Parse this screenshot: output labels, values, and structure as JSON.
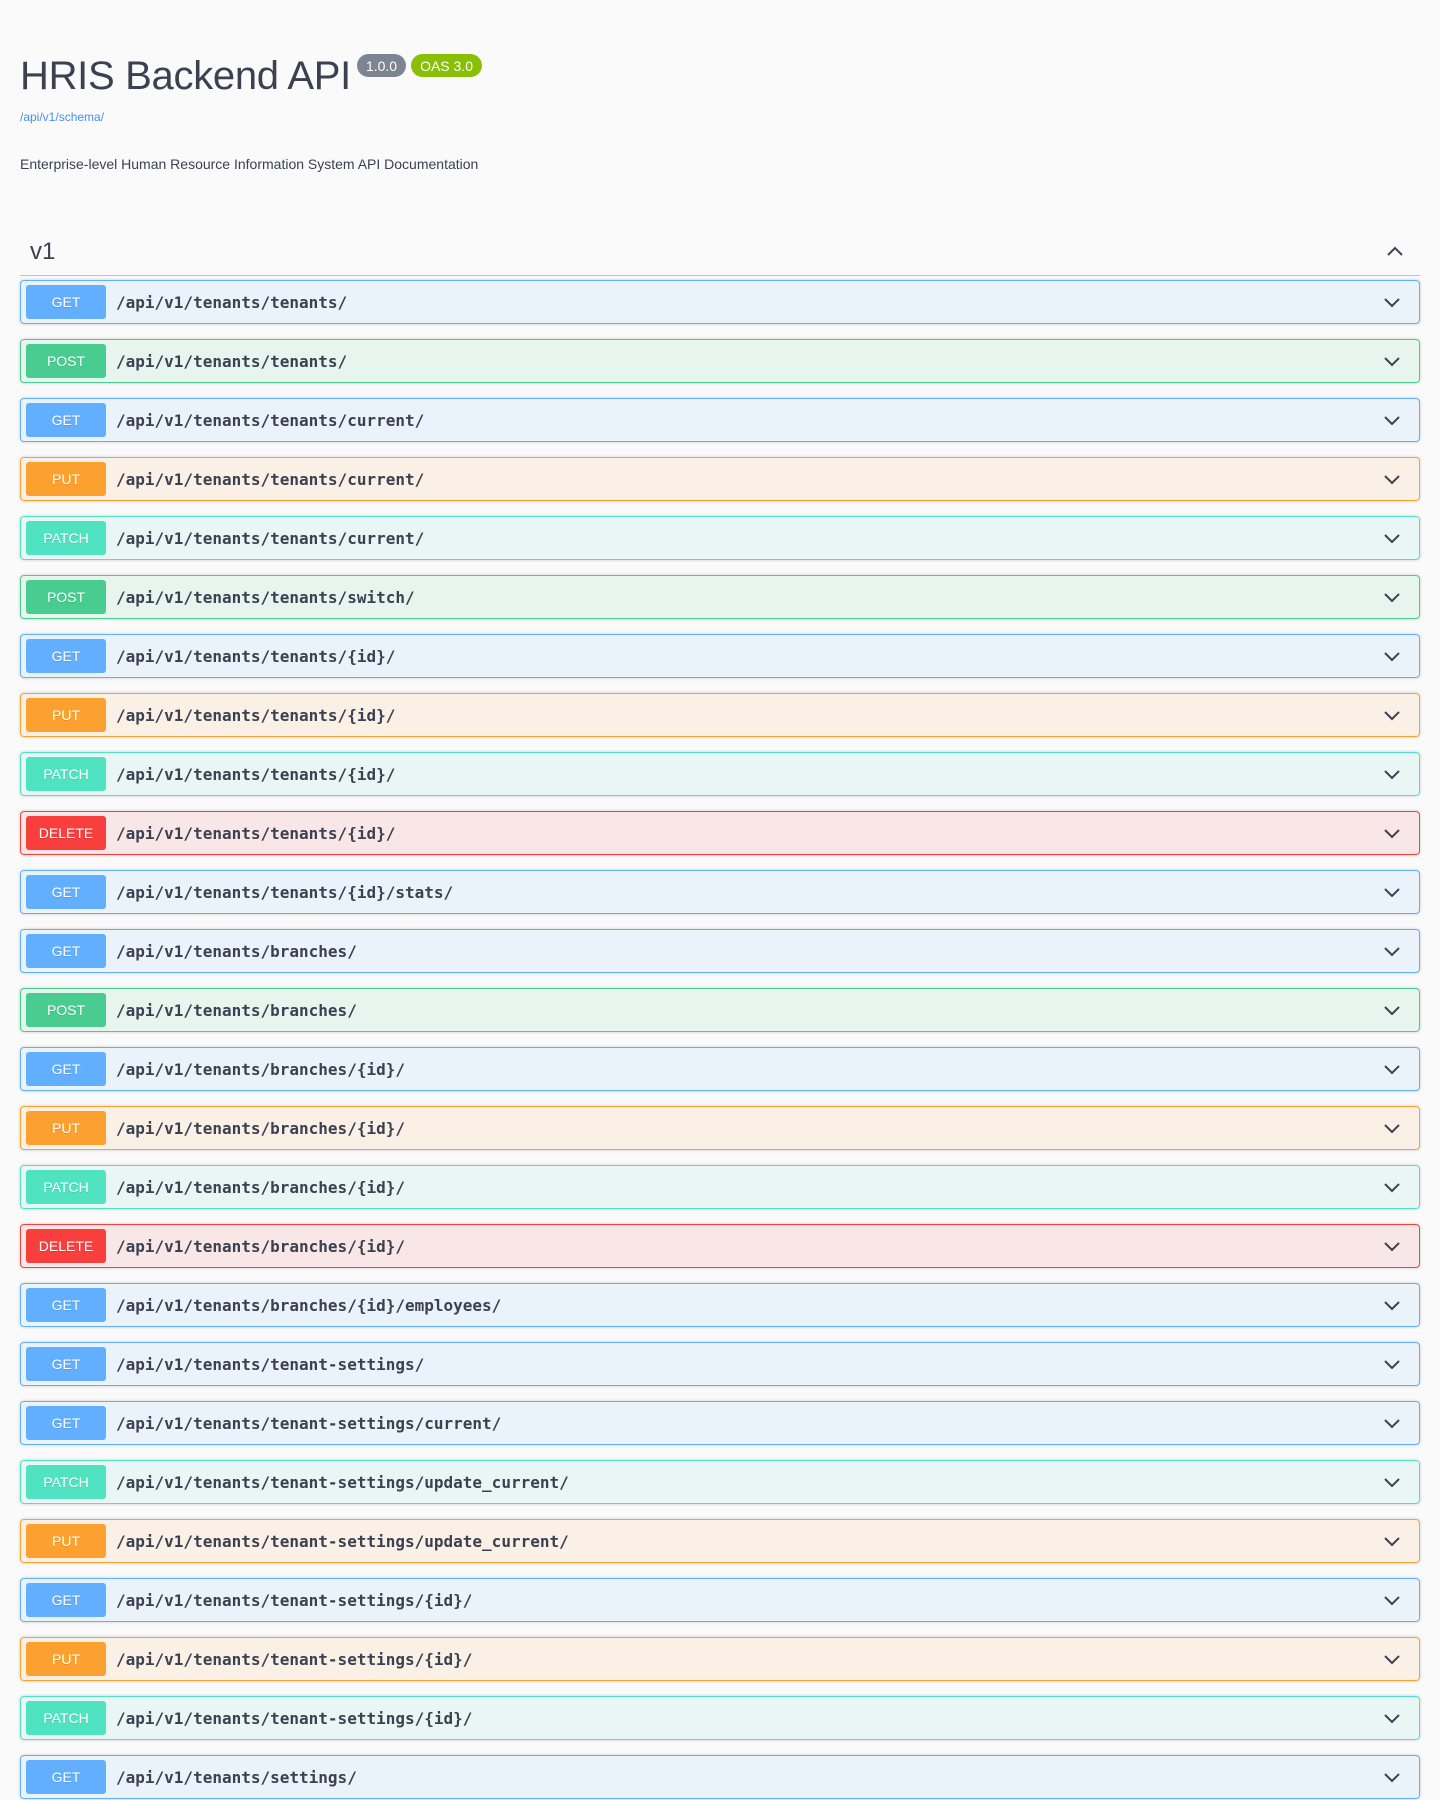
{
  "info": {
    "title": "HRIS Backend API",
    "version": "1.0.0",
    "oas": "OAS 3.0",
    "schema_link": "/api/v1/schema/",
    "description": "Enterprise-level Human Resource Information System API Documentation"
  },
  "section": {
    "title": "v1",
    "toggle_icon": "chevron-up-icon"
  },
  "colors": {
    "get": "#61affe",
    "post": "#49cc90",
    "put": "#fca130",
    "patch": "#50e3c2",
    "delete": "#f93e3e"
  },
  "operations": [
    {
      "method": "GET",
      "path": "/api/v1/tenants/tenants/"
    },
    {
      "method": "POST",
      "path": "/api/v1/tenants/tenants/"
    },
    {
      "method": "GET",
      "path": "/api/v1/tenants/tenants/current/"
    },
    {
      "method": "PUT",
      "path": "/api/v1/tenants/tenants/current/"
    },
    {
      "method": "PATCH",
      "path": "/api/v1/tenants/tenants/current/"
    },
    {
      "method": "POST",
      "path": "/api/v1/tenants/tenants/switch/"
    },
    {
      "method": "GET",
      "path": "/api/v1/tenants/tenants/{id}/"
    },
    {
      "method": "PUT",
      "path": "/api/v1/tenants/tenants/{id}/"
    },
    {
      "method": "PATCH",
      "path": "/api/v1/tenants/tenants/{id}/"
    },
    {
      "method": "DELETE",
      "path": "/api/v1/tenants/tenants/{id}/"
    },
    {
      "method": "GET",
      "path": "/api/v1/tenants/tenants/{id}/stats/"
    },
    {
      "method": "GET",
      "path": "/api/v1/tenants/branches/"
    },
    {
      "method": "POST",
      "path": "/api/v1/tenants/branches/"
    },
    {
      "method": "GET",
      "path": "/api/v1/tenants/branches/{id}/"
    },
    {
      "method": "PUT",
      "path": "/api/v1/tenants/branches/{id}/"
    },
    {
      "method": "PATCH",
      "path": "/api/v1/tenants/branches/{id}/"
    },
    {
      "method": "DELETE",
      "path": "/api/v1/tenants/branches/{id}/"
    },
    {
      "method": "GET",
      "path": "/api/v1/tenants/branches/{id}/employees/"
    },
    {
      "method": "GET",
      "path": "/api/v1/tenants/tenant-settings/"
    },
    {
      "method": "GET",
      "path": "/api/v1/tenants/tenant-settings/current/"
    },
    {
      "method": "PATCH",
      "path": "/api/v1/tenants/tenant-settings/update_current/"
    },
    {
      "method": "PUT",
      "path": "/api/v1/tenants/tenant-settings/update_current/"
    },
    {
      "method": "GET",
      "path": "/api/v1/tenants/tenant-settings/{id}/"
    },
    {
      "method": "PUT",
      "path": "/api/v1/tenants/tenant-settings/{id}/"
    },
    {
      "method": "PATCH",
      "path": "/api/v1/tenants/tenant-settings/{id}/"
    },
    {
      "method": "GET",
      "path": "/api/v1/tenants/settings/"
    }
  ]
}
